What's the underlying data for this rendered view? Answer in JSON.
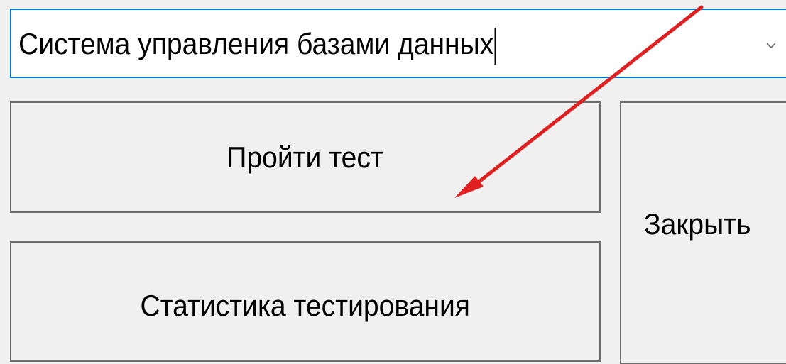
{
  "combo": {
    "selected": "Система управления базами данных",
    "icon": "chevron-down-icon"
  },
  "buttons": {
    "start_test": "Пройти тест",
    "statistics": "Статистика тестирования",
    "close": "Закрыть"
  },
  "annotation": {
    "type": "arrow",
    "color": "#e02020"
  }
}
